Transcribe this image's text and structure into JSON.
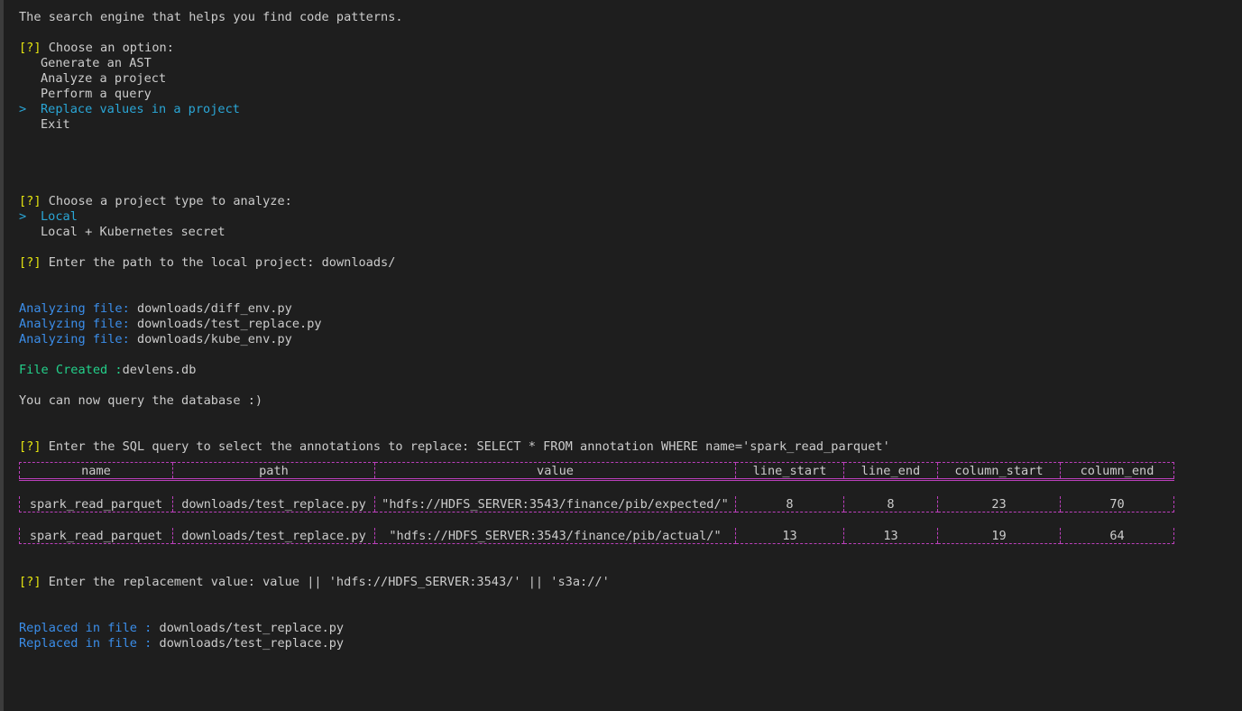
{
  "intro": "The search engine that helps you find code patterns.",
  "prompt_marker": "[?]",
  "pointer": ">",
  "menu": {
    "question": "Choose an option:",
    "options": [
      "Generate an AST",
      "Analyze a project",
      "Perform a query",
      "Replace values in a project",
      "Exit"
    ],
    "selected": "Replace values in a project"
  },
  "project_type": {
    "question": "Choose a project type to analyze:",
    "options": [
      "Local",
      "Local + Kubernetes secret"
    ],
    "selected": "Local"
  },
  "path_prompt": {
    "question": "Enter the path to the local project:",
    "answer": "downloads/"
  },
  "analyzing": {
    "label": "Analyzing file:",
    "files": [
      "downloads/diff_env.py",
      "downloads/test_replace.py",
      "downloads/kube_env.py"
    ]
  },
  "file_created": {
    "label": "File Created :",
    "value": "devlens.db"
  },
  "query_msg": "You can now query the database :)",
  "sql_prompt": {
    "question": "Enter the SQL query to select the annotations to replace:",
    "answer": "SELECT * FROM annotation WHERE name='spark_read_parquet'"
  },
  "table": {
    "headers": [
      "name",
      "path",
      "value",
      "line_start",
      "line_end",
      "column_start",
      "column_end"
    ],
    "rows": [
      [
        "spark_read_parquet",
        "downloads/test_replace.py",
        "\"hdfs://HDFS_SERVER:3543/finance/pib/expected/\"",
        "8",
        "8",
        "23",
        "70"
      ],
      [
        "spark_read_parquet",
        "downloads/test_replace.py",
        "\"hdfs://HDFS_SERVER:3543/finance/pib/actual/\"",
        "13",
        "13",
        "19",
        "64"
      ]
    ]
  },
  "replace_prompt": {
    "question": "Enter the replacement value:",
    "answer": "value || 'hdfs://HDFS_SERVER:3543/' || 's3a://'"
  },
  "replaced": {
    "label": "Replaced in file :",
    "files": [
      "downloads/test_replace.py",
      "downloads/test_replace.py"
    ]
  },
  "colors": {
    "background": "#1e1e1e",
    "text": "#cccccc",
    "prompt_yellow": "#e5e510",
    "selected_cyan": "#2aa6d6",
    "info_blue": "#3b8eea",
    "success_green": "#23d18b",
    "table_border_magenta": "#bc3fbc"
  }
}
